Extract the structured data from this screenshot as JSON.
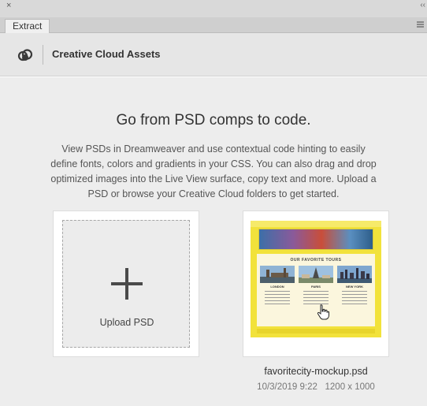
{
  "panel": {
    "close_glyph": "×",
    "collapse_glyph": "‹‹",
    "tab_label": "Extract"
  },
  "header": {
    "title": "Creative Cloud Assets",
    "icon": "creative-cloud-icon"
  },
  "main": {
    "headline": "Go from PSD comps to code.",
    "description": "View PSDs in Dreamweaver and use contextual code hinting to easily define fonts, colors and gradients in your CSS. You can also drag and drop optimized images into the Live View surface, copy text and more. Upload a PSD or browse your Creative Cloud folders to get started."
  },
  "upload": {
    "label": "Upload PSD",
    "icon": "plus-icon"
  },
  "psd_file": {
    "name": "favoritecity-mockup.psd",
    "date": "10/3/2019 9:22",
    "dimensions": "1200 x 1000",
    "thumbnail": {
      "section_heading": "OUR FAVORITE TOURS",
      "cities": [
        "LONDON",
        "PARIS",
        "NEW YORK"
      ]
    }
  },
  "colors": {
    "accent_yellow": "#f2e23b",
    "panel_bg": "#ededed",
    "header_bg": "#e6e6e6"
  }
}
